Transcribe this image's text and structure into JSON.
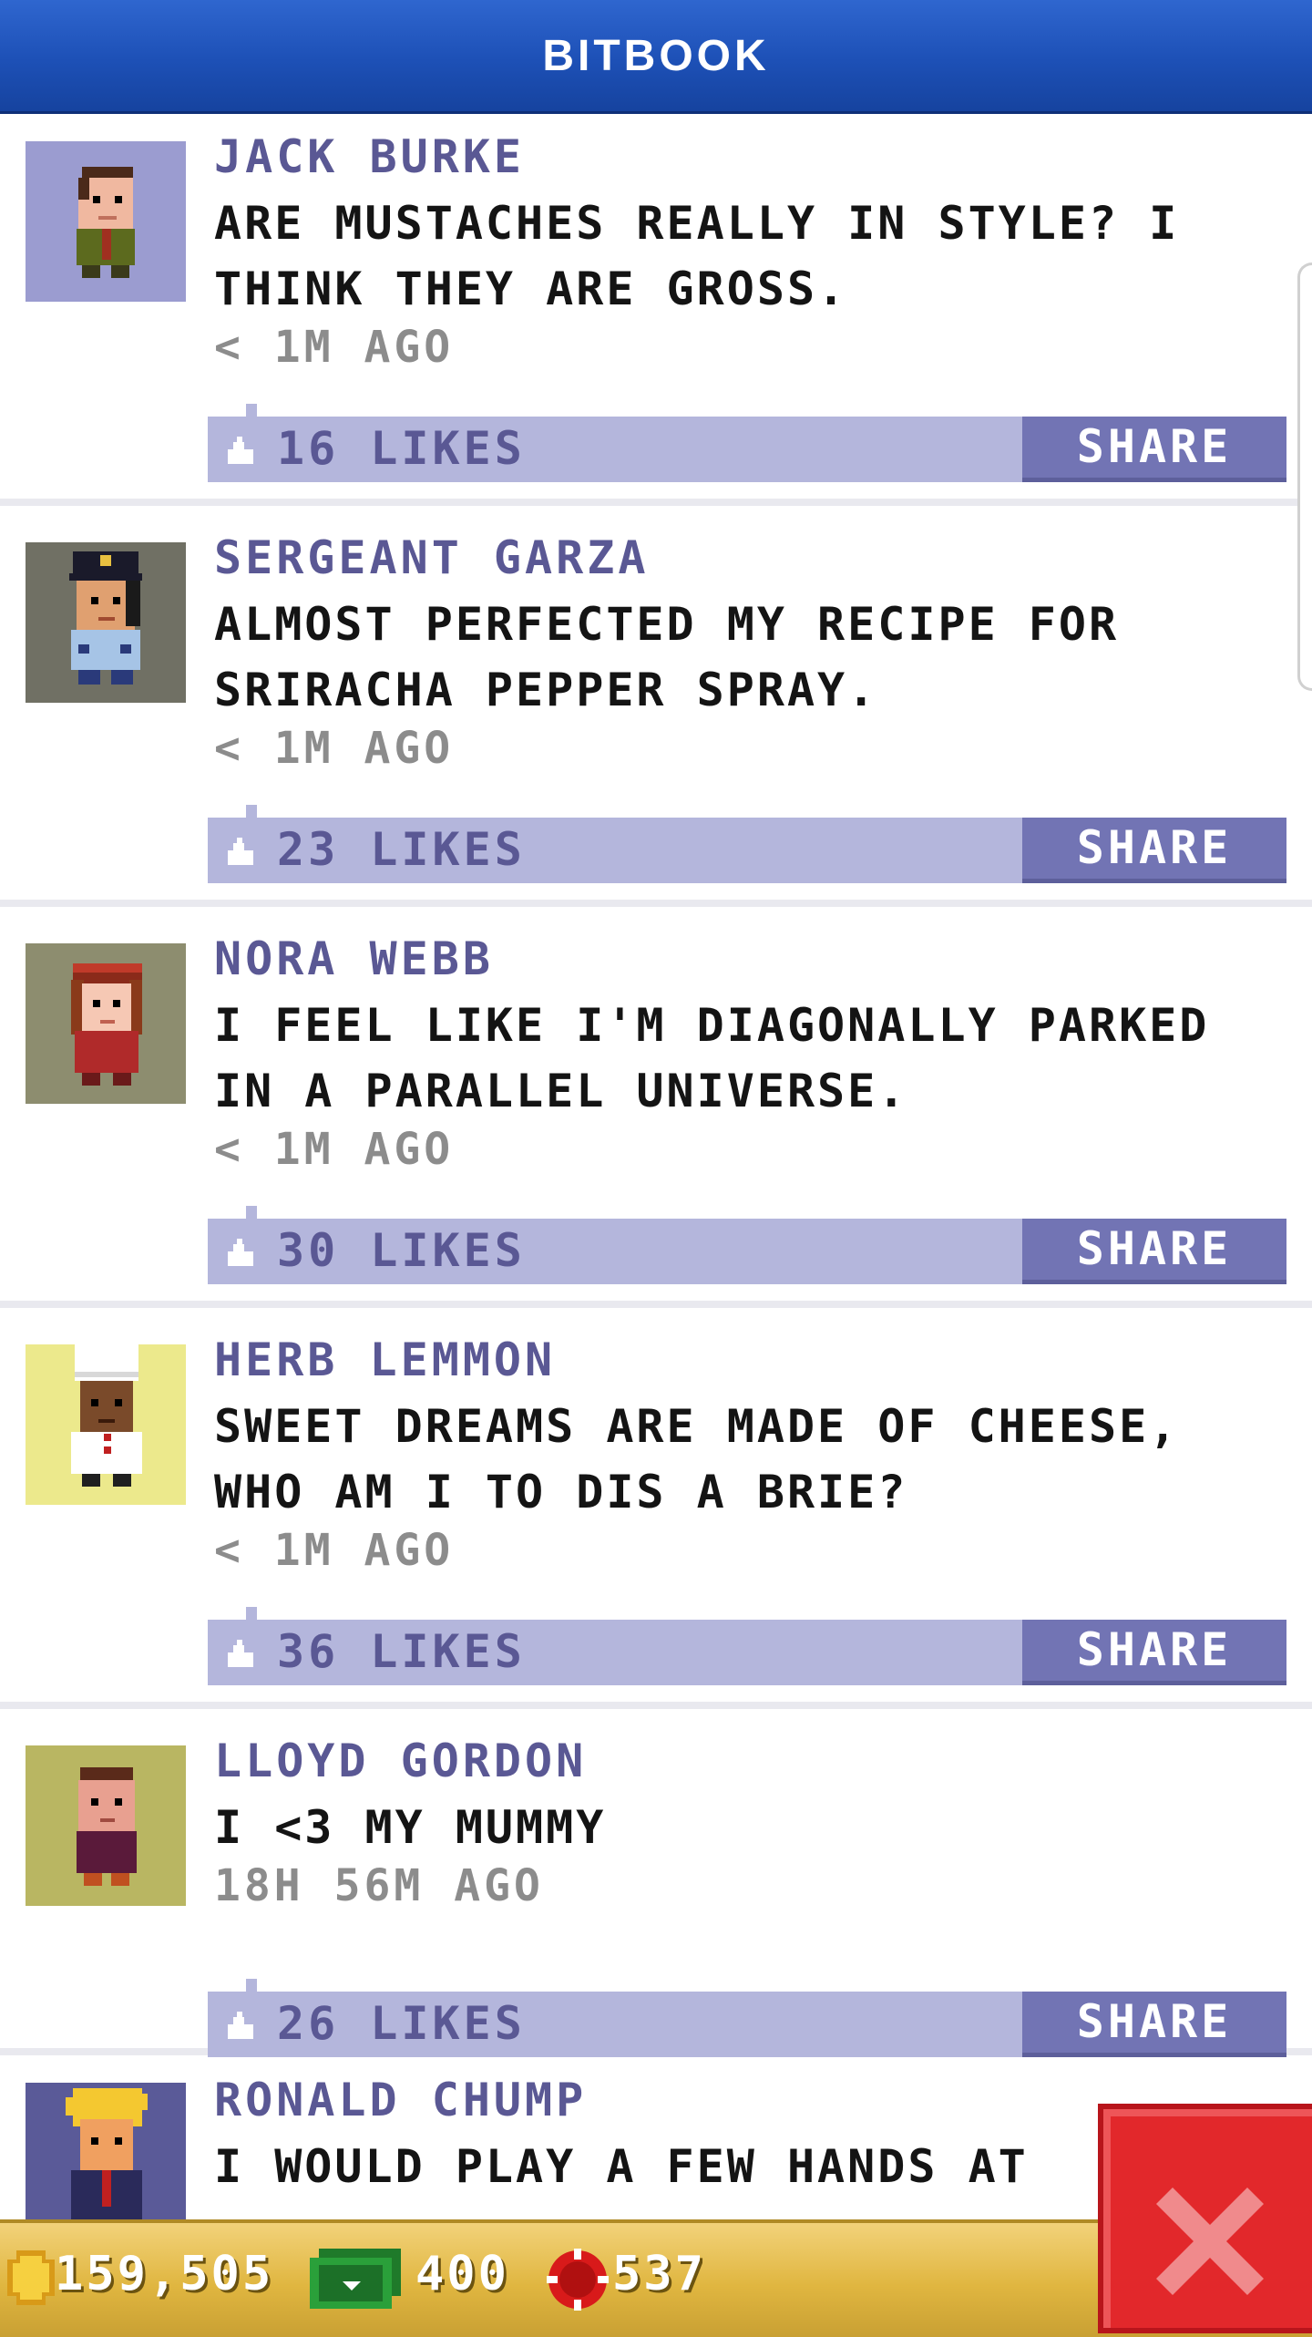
{
  "header": {
    "title": "BITBOOK"
  },
  "posts": [
    {
      "author": "JACK BURKE",
      "message": "ARE MUSTACHES REALLY IN STYLE? I THINK THEY ARE GROSS.",
      "time": "< 1M AGO",
      "likes": "16 LIKES",
      "share": "SHARE",
      "avatar_bg": "#9b9cd0"
    },
    {
      "author": "SERGEANT GARZA",
      "message": "ALMOST PERFECTED MY RECIPE FOR SRIRACHA PEPPER SPRAY.",
      "time": "< 1M AGO",
      "likes": "23 LIKES",
      "share": "SHARE",
      "avatar_bg": "#707064"
    },
    {
      "author": "NORA WEBB",
      "message": "I FEEL LIKE I'M DIAGONALLY PARKED IN A PARALLEL UNIVERSE.",
      "time": "< 1M AGO",
      "likes": "30 LIKES",
      "share": "SHARE",
      "avatar_bg": "#8d8d6f"
    },
    {
      "author": "HERB LEMMON",
      "message": "SWEET DREAMS ARE MADE OF CHEESE, WHO AM I TO DIS A BRIE?",
      "time": "< 1M AGO",
      "likes": "36 LIKES",
      "share": "SHARE",
      "avatar_bg": "#ece98c"
    },
    {
      "author": "LLOYD GORDON",
      "message": "I <3 MY MUMMY",
      "time": "18H 56M AGO",
      "likes": "26 LIKES",
      "share": "SHARE",
      "avatar_bg": "#b9b662"
    },
    {
      "author": "RONALD CHUMP",
      "message": "I WOULD PLAY A FEW HANDS AT",
      "avatar_bg": "#5a5a98"
    }
  ],
  "status": {
    "coins": "159,505",
    "bux": "400",
    "chips": "537"
  },
  "colors": {
    "header": "#1d50b6",
    "like_bar": "#b4b6dc",
    "share": "#7274b4",
    "close": "#e2282b",
    "status_bar": "#e0b640"
  },
  "icons": [
    "like-icon",
    "coin-icon",
    "bux-icon",
    "chip-icon",
    "close-icon"
  ]
}
